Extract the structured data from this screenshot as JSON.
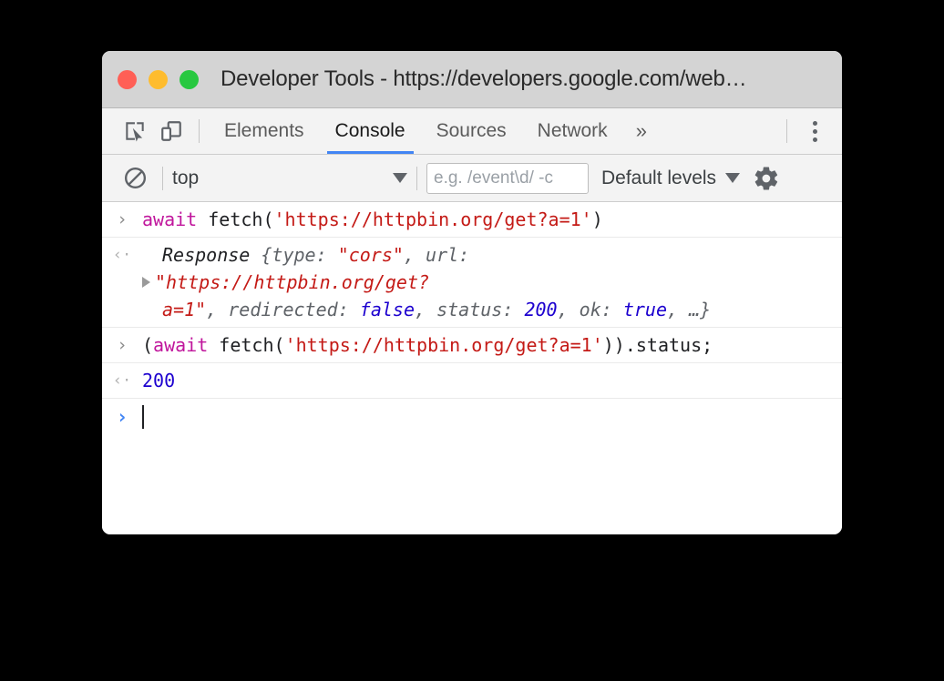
{
  "window": {
    "title": "Developer Tools - https://developers.google.com/web…",
    "traffic_lights": {
      "close_color": "#ff5f56",
      "minimize_color": "#febc2e",
      "maximize_color": "#28c840"
    }
  },
  "tabstrip": {
    "inspect_icon": "inspect-element-icon",
    "device_icon": "device-toolbar-icon",
    "tabs": [
      {
        "label": "Elements",
        "active": false
      },
      {
        "label": "Console",
        "active": true
      },
      {
        "label": "Sources",
        "active": false
      },
      {
        "label": "Network",
        "active": false
      }
    ],
    "more_tabs_label": "»",
    "menu_icon": "kebab-menu-icon",
    "active_underline_color": "#4285f4"
  },
  "console_toolbar": {
    "clear_icon": "clear-console-icon",
    "context": "top",
    "context_caret": "chevron-down-icon",
    "filter_placeholder": "e.g. /event\\d/ -c",
    "filter_value": "",
    "levels_label": "Default levels",
    "levels_caret": "chevron-down-icon",
    "settings_icon": "gear-icon"
  },
  "console": {
    "input_marker": "›",
    "output_marker": "‹·",
    "messages": [
      {
        "type": "input",
        "parts": [
          {
            "t": "await",
            "c": "kw"
          },
          {
            "t": " fetch(",
            "c": "plain"
          },
          {
            "t": "'https://httpbin.org/get?a=1'",
            "c": "str"
          },
          {
            "t": ")",
            "c": "plain"
          }
        ]
      },
      {
        "type": "output-object",
        "line1": [
          {
            "t": "Response ",
            "c": "obj-name"
          },
          {
            "t": "{",
            "c": "obj-punc"
          },
          {
            "t": "type",
            "c": "obj-prop"
          },
          {
            "t": ": ",
            "c": "obj-punc"
          },
          {
            "t": "\"cors\"",
            "c": "obj-str"
          },
          {
            "t": ", ",
            "c": "obj-punc"
          },
          {
            "t": "url",
            "c": "obj-prop"
          },
          {
            "t": ":",
            "c": "obj-punc"
          }
        ],
        "line2": [
          {
            "t": "\"https://httpbin.org/get?",
            "c": "obj-str"
          }
        ],
        "line3": [
          {
            "t": "a=1\"",
            "c": "obj-str"
          },
          {
            "t": ", ",
            "c": "obj-punc"
          },
          {
            "t": "redirected",
            "c": "obj-prop"
          },
          {
            "t": ": ",
            "c": "obj-punc"
          },
          {
            "t": "false",
            "c": "obj-val"
          },
          {
            "t": ", ",
            "c": "obj-punc"
          },
          {
            "t": "status",
            "c": "obj-prop"
          },
          {
            "t": ": ",
            "c": "obj-punc"
          },
          {
            "t": "200",
            "c": "obj-val"
          },
          {
            "t": ", ",
            "c": "obj-punc"
          },
          {
            "t": "ok",
            "c": "obj-prop"
          },
          {
            "t": ": ",
            "c": "obj-punc"
          },
          {
            "t": "true",
            "c": "obj-val"
          },
          {
            "t": ", …}",
            "c": "obj-punc"
          }
        ]
      },
      {
        "type": "input",
        "parts": [
          {
            "t": "(",
            "c": "plain"
          },
          {
            "t": "await",
            "c": "kw"
          },
          {
            "t": " fetch(",
            "c": "plain"
          },
          {
            "t": "'https://httpbin.org/get?a=1'",
            "c": "str"
          },
          {
            "t": ")).status;",
            "c": "plain"
          }
        ]
      },
      {
        "type": "output",
        "parts": [
          {
            "t": "200",
            "c": "num"
          }
        ]
      }
    ],
    "prompt": {
      "chevron": "›",
      "value": ""
    }
  }
}
